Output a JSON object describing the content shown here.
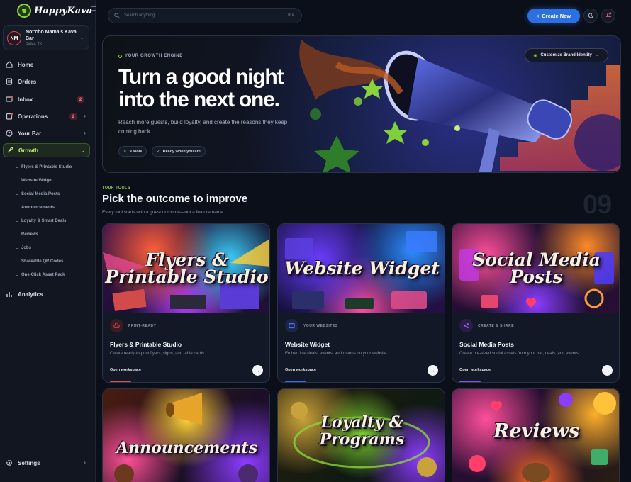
{
  "app": {
    "logo_text": "HappyKava"
  },
  "venue": {
    "initials": "NM",
    "name": "Not'cho Mama's Kava Bar",
    "location": "Dallas, TX"
  },
  "nav": {
    "home": "Home",
    "orders": "Orders",
    "inbox": "Inbox",
    "inbox_badge": "2",
    "operations": "Operations",
    "operations_badge": "2",
    "your_bar": "Your Bar",
    "growth": "Growth",
    "growth_sub": [
      "Flyers & Printable Studio",
      "Website Widget",
      "Social Media Posts",
      "Announcements",
      "Loyalty & Smart Deals",
      "Reviews",
      "Jobs",
      "Shareable QR Codes",
      "One-Click Asset Pack"
    ],
    "analytics": "Analytics",
    "settings": "Settings"
  },
  "topbar": {
    "search_placeholder": "Search anything...",
    "shortcut": "⌘ K",
    "create_label": "Create New"
  },
  "hero": {
    "eyebrow": "YOUR GROWTH ENGINE",
    "title": "Turn a good night into the next one.",
    "subtitle": "Reach more guests, build loyalty, and create the reasons they keep coming back.",
    "chip_tools": "9 tools",
    "chip_ready": "Ready when you are",
    "customize_label": "Customize Brand Identity"
  },
  "section": {
    "eyebrow": "YOUR TOOLS",
    "title": "Pick the outcome to improve",
    "subtitle": "Every tool starts with a guest outcome—not a feature name.",
    "count": "09"
  },
  "cards": [
    {
      "art": "Flyers & Printable Studio",
      "tag": "PRINT-READY",
      "title": "Flyers & Printable Studio",
      "desc": "Create ready-to-print flyers, signs, and table cards.",
      "open": "Open workspace",
      "accent": "#e0524f"
    },
    {
      "art": "Website Widget",
      "tag": "YOUR WEBSITES",
      "title": "Website Widget",
      "desc": "Embed live deals, events, and menus on your website.",
      "open": "Open workspace",
      "accent": "#3f6fe8"
    },
    {
      "art": "Social Media Posts",
      "tag": "CREATE & SHARE",
      "title": "Social Media Posts",
      "desc": "Create pre-sized social assets from your bar, deals, and events.",
      "open": "Open workspace",
      "accent": "#8a55e6"
    },
    {
      "art": "Announcements"
    },
    {
      "art": "Loyalty & Programs"
    },
    {
      "art": "Reviews"
    }
  ]
}
